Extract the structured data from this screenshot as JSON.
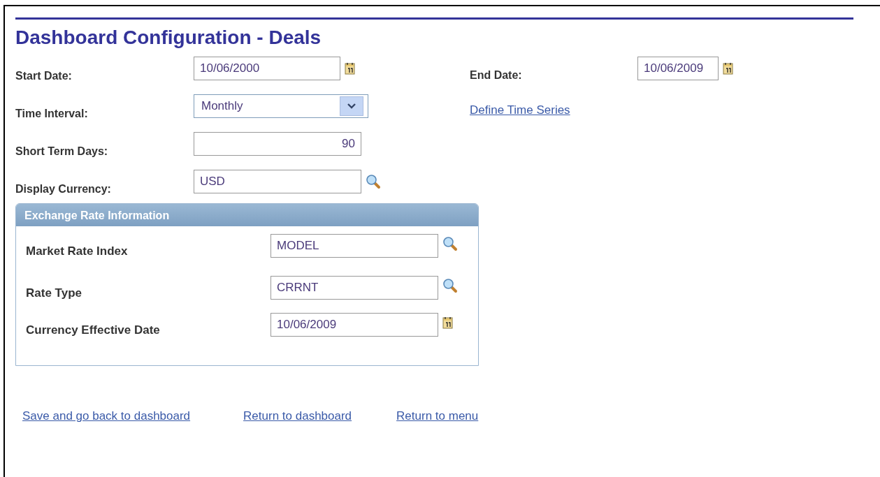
{
  "title": "Dashboard Configuration - Deals",
  "rows": [
    {
      "fields": [
        {
          "label": "Start Date:",
          "kind": "date",
          "value": "10/06/2000"
        },
        {
          "label": "End Date:",
          "kind": "date",
          "value": "10/06/2009"
        }
      ]
    },
    {
      "fields": [
        {
          "label": "Time Interval:",
          "kind": "select",
          "value": "Monthly"
        },
        {
          "kind": "link",
          "value": "Define Time Series"
        }
      ]
    },
    {
      "fields": [
        {
          "label": "Short Term Days:",
          "kind": "number",
          "value": "90"
        }
      ]
    },
    {
      "fields": [
        {
          "label": "Display Currency:",
          "kind": "lookup",
          "value": "USD"
        }
      ]
    }
  ],
  "group": {
    "title": "Exchange Rate Information",
    "fields": [
      {
        "label": "Market Rate Index",
        "kind": "lookup",
        "value": "MODEL"
      },
      {
        "label": "Rate Type",
        "kind": "lookup",
        "value": "CRRNT"
      },
      {
        "label": "Currency Effective Date",
        "kind": "date",
        "value": "10/06/2009"
      }
    ]
  },
  "links": [
    "Save and go back to dashboard",
    "Return to dashboard",
    "Return to menu"
  ]
}
